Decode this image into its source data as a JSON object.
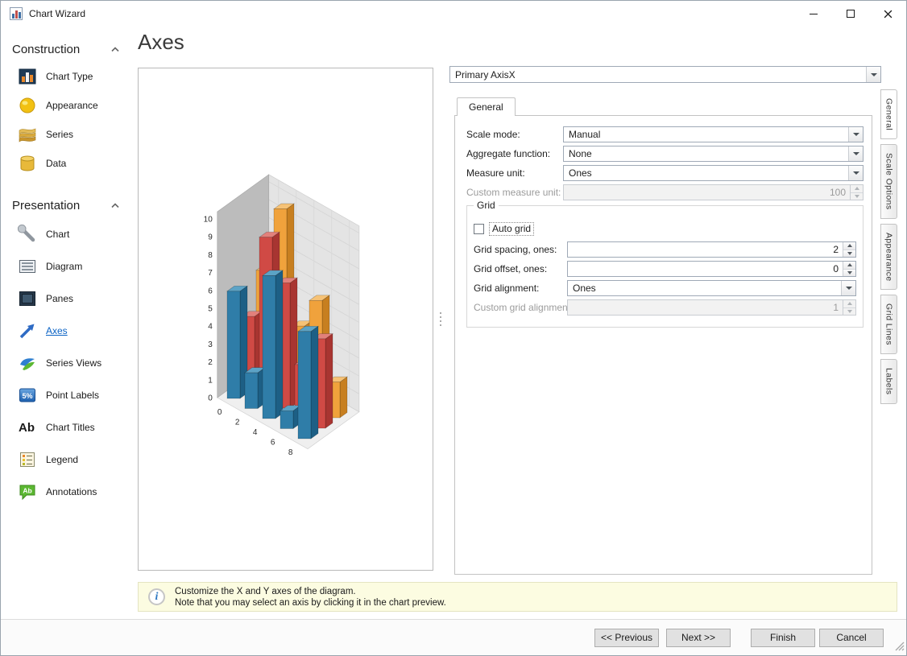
{
  "window": {
    "title": "Chart Wizard"
  },
  "sidebar": {
    "groups": [
      {
        "label": "Construction",
        "items": [
          {
            "label": "Chart Type"
          },
          {
            "label": "Appearance"
          },
          {
            "label": "Series"
          },
          {
            "label": "Data"
          }
        ]
      },
      {
        "label": "Presentation",
        "items": [
          {
            "label": "Chart"
          },
          {
            "label": "Diagram"
          },
          {
            "label": "Panes"
          },
          {
            "label": "Axes",
            "selected": true
          },
          {
            "label": "Series Views"
          },
          {
            "label": "Point Labels"
          },
          {
            "label": "Chart Titles"
          },
          {
            "label": "Legend"
          },
          {
            "label": "Annotations"
          }
        ]
      }
    ]
  },
  "page": {
    "title": "Axes"
  },
  "axis_selector": {
    "value": "Primary AxisX"
  },
  "tab": {
    "top_label": "General",
    "side_tabs": [
      "General",
      "Scale Options",
      "Appearance",
      "Grid Lines",
      "Labels"
    ],
    "side_selected": "General"
  },
  "form": {
    "scale_mode": {
      "label": "Scale mode:",
      "value": "Manual"
    },
    "aggregate_function": {
      "label": "Aggregate function:",
      "value": "None"
    },
    "measure_unit": {
      "label": "Measure unit:",
      "value": "Ones"
    },
    "custom_measure_unit": {
      "label": "Custom measure unit:",
      "value": "100",
      "enabled": false
    },
    "grid": {
      "group_label": "Grid",
      "auto_grid": {
        "label": "Auto grid",
        "checked": false
      },
      "grid_spacing": {
        "label": "Grid spacing, ones:",
        "value": "2"
      },
      "grid_offset": {
        "label": "Grid offset, ones:",
        "value": "0"
      },
      "grid_alignment": {
        "label": "Grid alignment:",
        "value": "Ones"
      },
      "custom_grid_alignment": {
        "label": "Custom grid alignment:",
        "value": "1",
        "enabled": false
      }
    }
  },
  "info_bar": {
    "line1": "Customize the X and Y axes of the diagram.",
    "line2": "Note that you may select an axis by clicking it in the chart preview."
  },
  "footer": {
    "previous": "<< Previous",
    "next": "Next >>",
    "finish": "Finish",
    "cancel": "Cancel"
  },
  "chart_preview": {
    "type": "bar",
    "style": "3d-manhattan",
    "value_axis_ticks": [
      0,
      1,
      2,
      3,
      4,
      5,
      6,
      7,
      8,
      9,
      10
    ],
    "argument_axis_ticks": [
      0,
      2,
      4,
      6,
      8
    ],
    "series": [
      {
        "color": "#2f7da8",
        "color_side": "#1d5f85",
        "color_top": "#5ca3c6",
        "values": [
          6,
          2,
          8,
          1,
          6
        ]
      },
      {
        "color": "#d04a45",
        "color_side": "#a83531",
        "color_top": "#e2807b",
        "values": [
          4,
          9,
          7,
          3,
          5
        ]
      },
      {
        "color": "#f0a23c",
        "color_side": "#c77f20",
        "color_top": "#f6c276",
        "values": [
          6,
          10,
          4,
          6,
          2
        ]
      }
    ]
  }
}
